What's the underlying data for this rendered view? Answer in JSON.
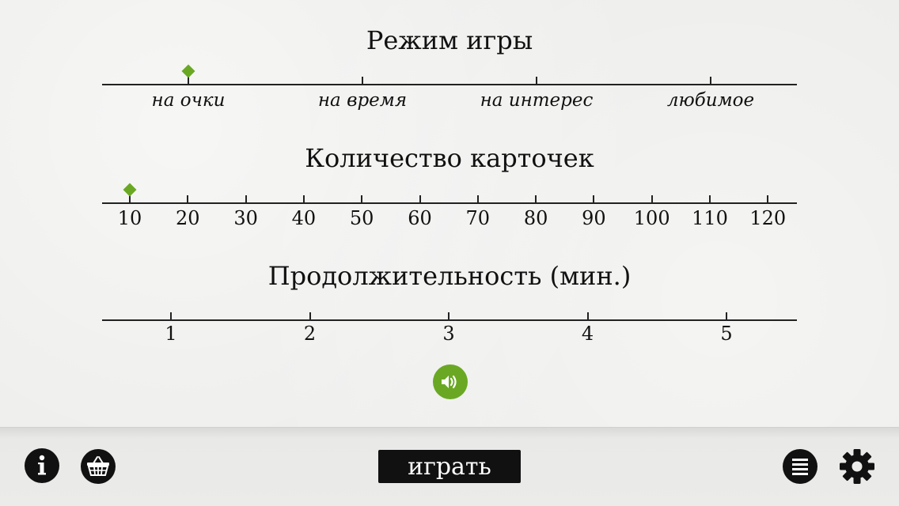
{
  "game_mode": {
    "title": "Режим игры",
    "options": [
      "на очки",
      "на время",
      "на интерес",
      "любимое"
    ],
    "selected_index": 0
  },
  "card_count": {
    "title": "Количество карточек",
    "ticks": [
      "10",
      "20",
      "30",
      "40",
      "50",
      "60",
      "70",
      "80",
      "90",
      "100",
      "110",
      "120"
    ],
    "selected_value": 10
  },
  "duration": {
    "title": "Продолжительность (мин.)",
    "ticks": [
      "1",
      "2",
      "3",
      "4",
      "5"
    ]
  },
  "toolbar": {
    "info_icon": "info-icon",
    "basket_icon": "basket-icon",
    "play_label": "играть",
    "list_icon": "list-icon",
    "settings_icon": "gear-icon"
  },
  "colors": {
    "accent": "#6aa823",
    "ink": "#111111",
    "paper": "#ececea"
  }
}
